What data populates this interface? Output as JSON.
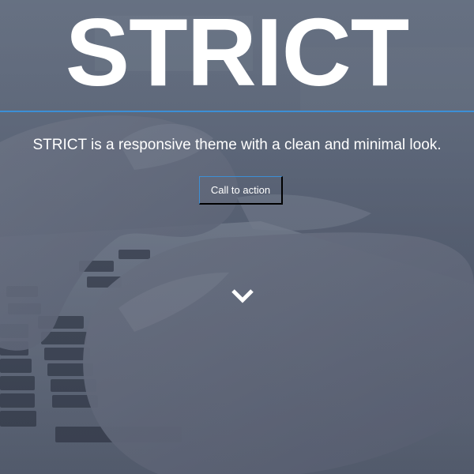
{
  "hero": {
    "title": "STRICT",
    "tagline": "STRICT is a responsive theme with a clean and minimal look.",
    "cta_label": "Call to action"
  },
  "icons": {
    "scroll_down": "chevron-down-icon"
  },
  "colors": {
    "accent": "#3c8fd6",
    "text": "#ffffff",
    "overlay": "#5c687a"
  }
}
